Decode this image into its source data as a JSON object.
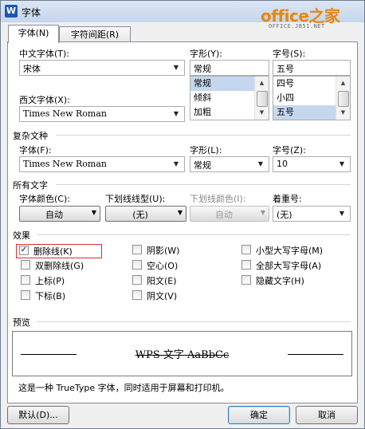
{
  "window": {
    "title": "字体",
    "app_icon_letter": "W"
  },
  "watermark": {
    "main": "office之家",
    "sub": "OFFICE.JB51.NET"
  },
  "tabs": [
    {
      "label": "字体(N)"
    },
    {
      "label": "字符间距(R)"
    }
  ],
  "font": {
    "chinese_label": "中文字体(T):",
    "chinese_value": "宋体",
    "western_label": "西文字体(X):",
    "western_value": "Times New Roman",
    "style_label": "字形(Y):",
    "style_value": "常规",
    "style_items": [
      "常规",
      "倾斜",
      "加粗"
    ],
    "size_label": "字号(S):",
    "size_value": "五号",
    "size_items": [
      "四号",
      "小四",
      "五号"
    ]
  },
  "complex": {
    "section": "复杂文种",
    "font_label": "字体(F):",
    "font_value": "Times New Roman",
    "style_label": "字形(L):",
    "style_value": "常规",
    "size_label": "字号(Z):",
    "size_value": "10"
  },
  "all_text": {
    "section": "所有文字",
    "color_label": "字体颜色(C):",
    "color_value": "自动",
    "underline_label": "下划线线型(U):",
    "underline_value": "(无)",
    "underline_color_label": "下划线颜色(I):",
    "underline_color_value": "自动",
    "emphasis_label": "着重号:",
    "emphasis_value": "(无)"
  },
  "effects": {
    "section": "效果",
    "strikethrough": "删除线(K)",
    "double_strikethrough": "双删除线(G)",
    "superscript": "上标(P)",
    "subscript": "下标(B)",
    "shadow": "阴影(W)",
    "outline": "空心(O)",
    "emboss": "阳文(E)",
    "engrave": "阴文(V)",
    "small_caps": "小型大写字母(M)",
    "all_caps": "全部大写字母(A)",
    "hidden": "隐藏文字(H)"
  },
  "preview": {
    "section": "预览",
    "sample": "WPS 文字 AaBbCc",
    "note": "这是一种 TrueType 字体，同时适用于屏幕和打印机。"
  },
  "buttons": {
    "default": "默认(D)...",
    "ok": "确定",
    "cancel": "取消"
  }
}
